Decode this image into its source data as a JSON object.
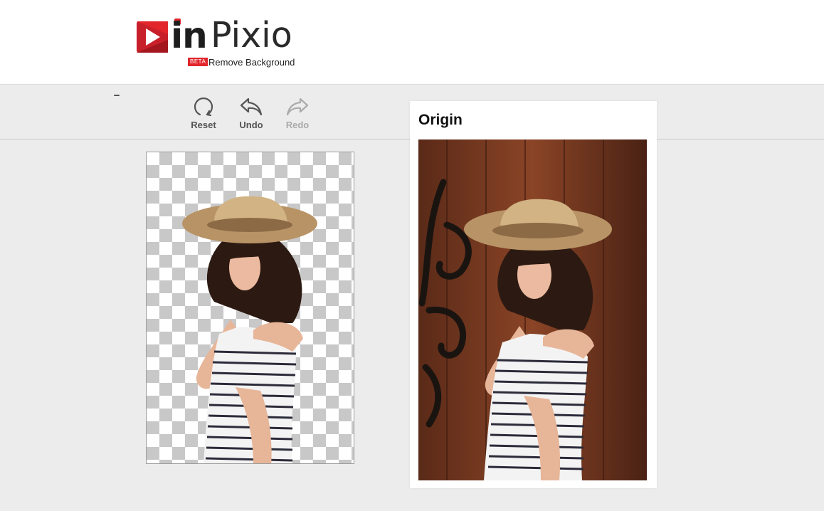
{
  "header": {
    "logo_in": "in",
    "logo_pixio": "Pixio",
    "beta_label": "BETA",
    "tagline": "Remove Background"
  },
  "toolbar": {
    "reset_label": "Reset",
    "undo_label": "Undo",
    "redo_label": "Redo"
  },
  "origin_panel": {
    "title": "Origin"
  },
  "colors": {
    "brand_red": "#e2252b",
    "background": "#ececec",
    "disabled": "#aaaaaa"
  },
  "icons": {
    "reset": "circular-arrow-icon",
    "undo": "undo-arrow-icon",
    "redo": "redo-arrow-icon"
  }
}
